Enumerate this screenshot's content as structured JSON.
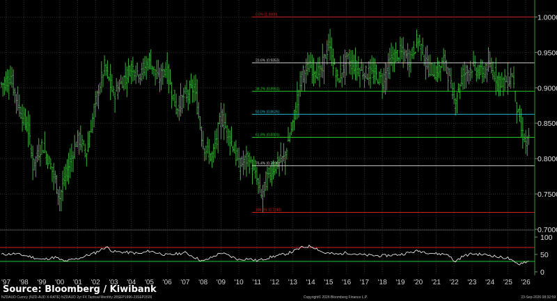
{
  "chart_data": {
    "type": "bar",
    "subtype": "ohlc-monthly",
    "x_ticks": [
      "'97",
      "'98",
      "'99",
      "'00",
      "'01",
      "'02",
      "'03",
      "'04",
      "'05",
      "'06",
      "'07",
      "'08",
      "'09",
      "'10",
      "'11",
      "'12",
      "'13",
      "'14",
      "'15",
      "'16",
      "'17",
      "'18",
      "'19",
      "'20",
      "'21",
      "'22",
      "'23",
      "'24",
      "'25",
      "'26"
    ],
    "y_ticks": [
      "1.0000",
      "0.9500",
      "0.9000",
      "0.8500",
      "0.8000",
      "0.7500",
      "0.7000"
    ],
    "ylim": [
      0.7,
      1.022
    ],
    "series": [
      {
        "monthly_close_approx": {
          "x": [
            1996.75,
            1997.25,
            1997.75,
            1998.25,
            1998.5,
            1999.0,
            1999.5,
            2000.0,
            2000.25,
            2000.5,
            2001.0,
            2001.5,
            2002.0,
            2002.5,
            2003.0,
            2003.5,
            2004.0,
            2004.5,
            2005.0,
            2005.5,
            2005.9,
            2006.5,
            2007.0,
            2007.5,
            2008.0,
            2008.5,
            2009.0,
            2009.5,
            2010.0,
            2010.5,
            2011.0,
            2011.25,
            2011.5,
            2012.0,
            2012.5,
            2013.0,
            2013.5,
            2014.0,
            2014.5,
            2015.0,
            2015.5,
            2016.0,
            2016.5,
            2017.0,
            2017.5,
            2018.0,
            2018.5,
            2019.0,
            2019.5,
            2020.0,
            2020.5,
            2021.0,
            2021.5,
            2022.0,
            2022.5,
            2023.0,
            2023.5,
            2024.0,
            2024.5,
            2025.0,
            2025.25,
            2025.5,
            2025.75,
            2026.0,
            2026.2
          ],
          "y": [
            0.905,
            0.915,
            0.87,
            0.84,
            0.79,
            0.82,
            0.79,
            0.745,
            0.77,
            0.79,
            0.83,
            0.81,
            0.88,
            0.93,
            0.89,
            0.91,
            0.93,
            0.92,
            0.94,
            0.91,
            0.93,
            0.87,
            0.89,
            0.9,
            0.82,
            0.8,
            0.86,
            0.83,
            0.79,
            0.8,
            0.77,
            0.745,
            0.77,
            0.79,
            0.8,
            0.85,
            0.92,
            0.93,
            0.92,
            0.96,
            0.91,
            0.94,
            0.93,
            0.92,
            0.92,
            0.91,
            0.94,
            0.95,
            0.94,
            0.97,
            0.93,
            0.92,
            0.94,
            0.88,
            0.92,
            0.93,
            0.92,
            0.93,
            0.91,
            0.91,
            0.92,
            0.87,
            0.84,
            0.82,
            0.825
          ]
        }
      }
    ],
    "fibonacci_levels": [
      {
        "label": "0.0% (1.0000)",
        "value": 1.0,
        "color": "#d02020"
      },
      {
        "label": "23.6% (0.9353)",
        "value": 0.9353,
        "color": "#cccccc"
      },
      {
        "label": "38.2% (0.8951)",
        "value": 0.8951,
        "color": "#22cc22"
      },
      {
        "label": "50.0% (0.8626)",
        "value": 0.8626,
        "color": "#20b8c8"
      },
      {
        "label": "61.8% (0.8301)",
        "value": 0.8301,
        "color": "#22cc22"
      },
      {
        "label": "76.4% (0.7899)",
        "value": 0.7899,
        "color": "#cccccc"
      },
      {
        "label": "100.0% (0.7240)",
        "value": 0.724,
        "color": "#d02020"
      }
    ],
    "indicator": {
      "name": "RSI",
      "y_ticks": [
        "100",
        "50",
        "0"
      ],
      "ylim": [
        -10,
        110
      ],
      "bands": [
        {
          "value": 70,
          "color": "#d02020"
        },
        {
          "value": 30,
          "color": "#22cc22"
        }
      ],
      "x": [
        1996.75,
        1997.5,
        1998.25,
        1999.0,
        1999.75,
        2000.25,
        2001.0,
        2002.0,
        2002.6,
        2003.0,
        2004.0,
        2004.5,
        2005.0,
        2006.0,
        2007.0,
        2008.0,
        2008.5,
        2009.0,
        2010.0,
        2010.5,
        2011.0,
        2012.0,
        2012.5,
        2013.0,
        2013.5,
        2014.0,
        2014.3,
        2014.7,
        2015.5,
        2016.0,
        2017.0,
        2018.0,
        2019.0,
        2019.5,
        2020.0,
        2021.0,
        2021.7,
        2022.0,
        2022.5,
        2023.0,
        2024.0,
        2024.5,
        2025.0,
        2025.3,
        2025.6,
        2025.9,
        2026.2
      ],
      "y": [
        50,
        52,
        45,
        35,
        42,
        30,
        38,
        55,
        72,
        58,
        55,
        52,
        60,
        48,
        55,
        30,
        42,
        55,
        35,
        38,
        32,
        45,
        50,
        58,
        70,
        74,
        68,
        55,
        50,
        55,
        48,
        46,
        50,
        55,
        60,
        52,
        50,
        28,
        45,
        52,
        48,
        42,
        40,
        28,
        22,
        28,
        30
      ]
    },
    "legend": "none",
    "grid": true
  },
  "source_label": "Source: Bloomberg / Kiwibank",
  "footer": {
    "left": "NZDAUD Curncy (NZD-AUD X-RATE) NZDAUD 2yr FX Tactical Monthly 28SEP1996-23SEP2026",
    "center": "Copyright© 2026 Bloomberg Finance L.P.",
    "right": "23-Sep-2026 08:32:59"
  },
  "colors": {
    "price": "#3fae3f",
    "rsi": "#e6e6e6",
    "grid": "#333333",
    "background": "#000000"
  }
}
